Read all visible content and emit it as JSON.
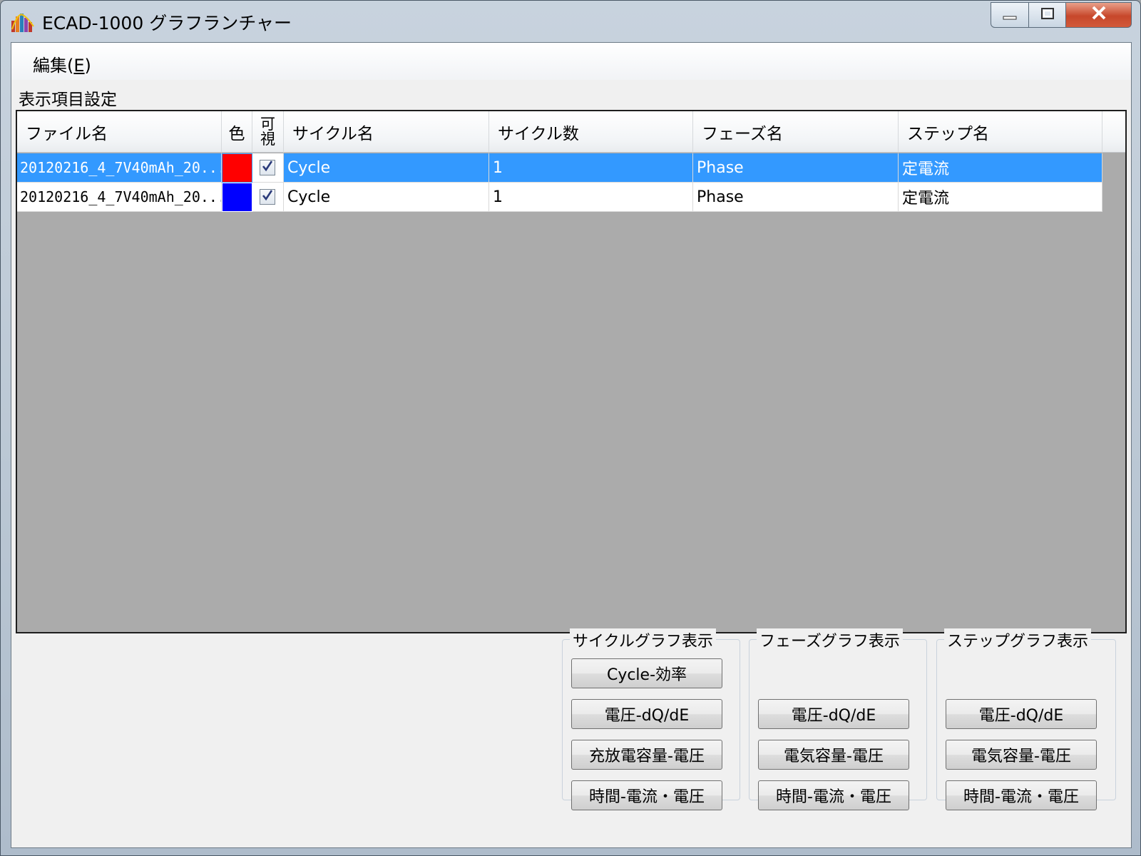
{
  "window": {
    "title": "ECAD-1000 グラフランチャー",
    "controls": {
      "minimize_icon": "minimize-icon",
      "maximize_icon": "maximize-icon",
      "close_icon": "close-icon"
    }
  },
  "menu": {
    "edit_label": "編集(",
    "edit_mnemonic": "E",
    "edit_suffix": ")"
  },
  "section": {
    "label": "表示項目設定"
  },
  "table": {
    "columns": [
      "ファイル名",
      "色",
      "可視",
      "サイクル名",
      "サイクル数",
      "フェーズ名",
      "ステップ名"
    ],
    "visible_header_line1": "可",
    "visible_header_line2": "視",
    "rows": [
      {
        "file": "20120216_4_7V40mAh_20...",
        "color": "#ff0000",
        "visible": true,
        "cycle_name": "Cycle",
        "cycle_count": "1",
        "phase": "Phase",
        "step": "定電流",
        "selected": true
      },
      {
        "file": "20120216_4_7V40mAh_20...",
        "color": "#0000ff",
        "visible": true,
        "cycle_name": "Cycle",
        "cycle_count": "1",
        "phase": "Phase",
        "step": "定電流",
        "selected": false
      }
    ]
  },
  "groups": {
    "cycle": {
      "title": "サイクルグラフ表示",
      "buttons": [
        "Cycle-効率",
        "電圧-dQ/dE",
        "充放電容量-電圧",
        "時間-電流・電圧"
      ]
    },
    "phase": {
      "title": "フェーズグラフ表示",
      "buttons": [
        "電圧-dQ/dE",
        "電気容量-電圧",
        "時間-電流・電圧"
      ]
    },
    "step": {
      "title": "ステップグラフ表示",
      "buttons": [
        "電圧-dQ/dE",
        "電気容量-電圧",
        "時間-電流・電圧"
      ]
    }
  },
  "colors": {
    "selection": "#3399ff",
    "grid_background": "#ababab"
  }
}
